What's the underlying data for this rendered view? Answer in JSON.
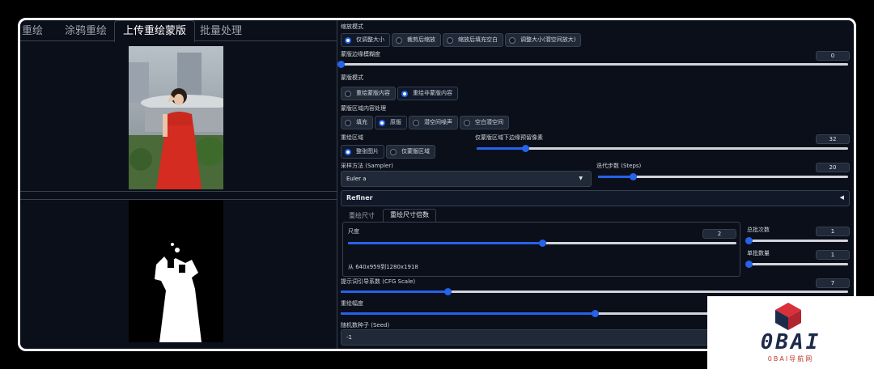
{
  "tabs": [
    {
      "label": "重绘"
    },
    {
      "label": "涂鸦重绘"
    },
    {
      "label": "上传重绘蒙版"
    },
    {
      "label": "批量处理"
    }
  ],
  "resize_mode": {
    "label": "缩放模式",
    "options": [
      "仅调整大小",
      "裁剪后缩放",
      "缩放后填充空白",
      "调整大小(潜空间放大)"
    ],
    "selected": 0
  },
  "mask_blur": {
    "label": "蒙版边缘模糊度",
    "value": "0",
    "fraction": 0
  },
  "mask_mode": {
    "label": "蒙版模式",
    "options": [
      "重绘蒙版内容",
      "重绘非蒙版内容"
    ],
    "selected": 1
  },
  "masked_content": {
    "label": "蒙版区域内容处理",
    "options": [
      "填充",
      "原版",
      "潜空间噪声",
      "空白潜空间"
    ],
    "selected": 1
  },
  "inpaint_area": {
    "label": "重绘区域",
    "options": [
      "整张图片",
      "仅蒙版区域"
    ],
    "selected": 0
  },
  "padding": {
    "label": "仅蒙版区域下边缘预留像素",
    "value": "32",
    "fraction": 0.13
  },
  "sampler": {
    "label": "采样方法 (Sampler)",
    "value": "Euler a",
    "caret": "▼"
  },
  "steps": {
    "label": "迭代步数 (Steps)",
    "value": "20",
    "fraction": 0.14
  },
  "refiner": {
    "label": "Refiner",
    "caret": "◀"
  },
  "size_tabs": [
    {
      "label": "重绘尺寸"
    },
    {
      "label": "重绘尺寸倍数"
    }
  ],
  "scale": {
    "label": "尺度",
    "value": "2",
    "fraction": 0.5,
    "note": "从 640x959到1280x1918"
  },
  "batch_count": {
    "label": "总批次数",
    "value": "1",
    "fraction": 0
  },
  "batch_size": {
    "label": "单批数量",
    "value": "1",
    "fraction": 0
  },
  "cfg": {
    "label": "提示词引导系数 (CFG Scale)",
    "value": "7",
    "fraction": 0.21
  },
  "denoise": {
    "label": "重绘幅度",
    "fraction": 0.5
  },
  "seed": {
    "label": "随机数种子 (Seed)",
    "value": "-1"
  },
  "watermark": {
    "name": "0BAI",
    "sub": "0BAI导航网"
  },
  "colors": {
    "accent": "#2563eb",
    "background": "#0b0f19",
    "logo_red": "#d9303a",
    "logo_navy": "#1e2a4a"
  }
}
